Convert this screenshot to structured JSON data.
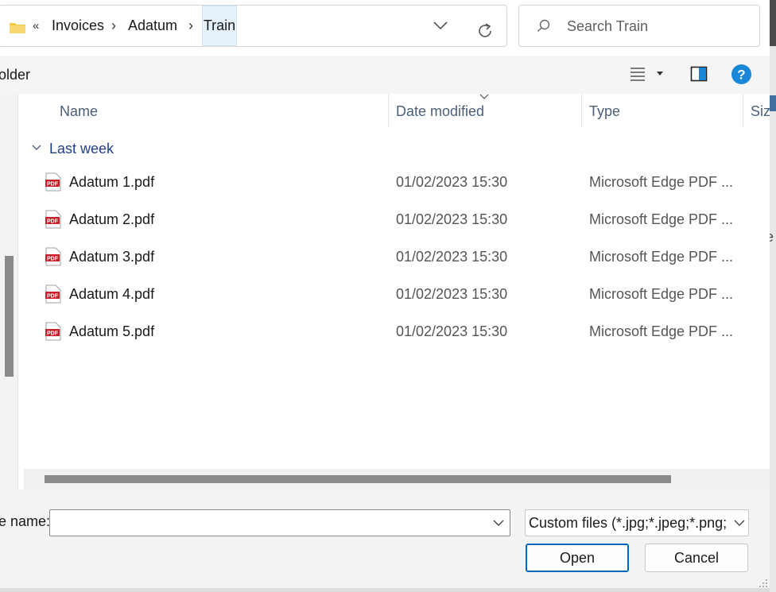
{
  "address_bar": {
    "overflow_label": "«",
    "crumbs": [
      "Invoices",
      "Adatum",
      "Train"
    ],
    "separator": "›"
  },
  "search": {
    "placeholder": "Search Train"
  },
  "command_bar": {
    "folder_label": "older"
  },
  "columns": {
    "name": "Name",
    "date": "Date modified",
    "type": "Type",
    "size": "Siz"
  },
  "group_label": "Last week",
  "files": [
    {
      "name": "Adatum 1.pdf",
      "date": "01/02/2023 15:30",
      "type": "Microsoft Edge PDF ..."
    },
    {
      "name": "Adatum 2.pdf",
      "date": "01/02/2023 15:30",
      "type": "Microsoft Edge PDF ..."
    },
    {
      "name": "Adatum 3.pdf",
      "date": "01/02/2023 15:30",
      "type": "Microsoft Edge PDF ..."
    },
    {
      "name": "Adatum 4.pdf",
      "date": "01/02/2023 15:30",
      "type": "Microsoft Edge PDF ..."
    },
    {
      "name": "Adatum 5.pdf",
      "date": "01/02/2023 15:30",
      "type": "Microsoft Edge PDF ..."
    }
  ],
  "bottom": {
    "file_name_label": "e name:",
    "file_name_value": "",
    "filter_label": "Custom files (*.jpg;*.jpeg;*.png;",
    "open_label": "Open",
    "cancel_label": "Cancel"
  },
  "edge_text": "e",
  "colors": {
    "accent": "#0067c0",
    "selected_crumb": "#e5f1fb",
    "pdf_red": "#c8202b",
    "help_blue": "#1a86d8",
    "group_text": "#1f3f8f"
  },
  "icons": [
    "folder-icon",
    "chevron-down-icon",
    "refresh-icon",
    "search-icon",
    "view-list-icon",
    "preview-pane-icon",
    "help-icon",
    "pdf-file-icon"
  ]
}
